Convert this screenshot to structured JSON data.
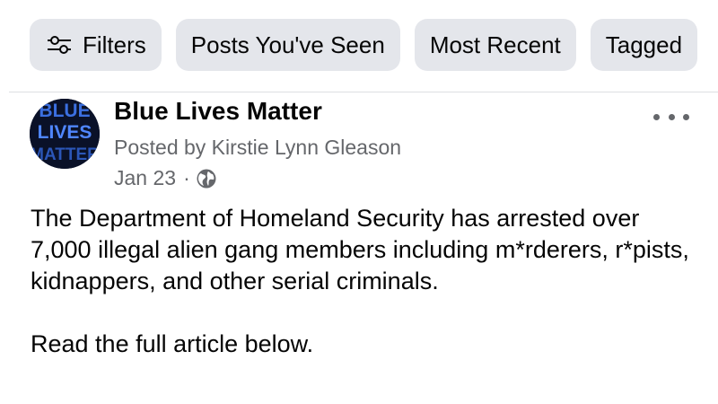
{
  "filters": {
    "chips": [
      {
        "label": "Filters",
        "icon": "sliders-icon"
      },
      {
        "label": "Posts You've Seen"
      },
      {
        "label": "Most Recent"
      },
      {
        "label": "Tagged"
      }
    ]
  },
  "post": {
    "avatar": {
      "icon": "page-avatar",
      "text_lines": [
        "BLUE",
        "LIVES",
        "MATTER"
      ]
    },
    "page_name": "Blue Lives Matter",
    "posted_by": "Posted by Kirstie Lynn Gleason",
    "date": "Jan 23",
    "separator": "·",
    "privacy_icon": "globe-icon",
    "more_icon": "more-options-icon",
    "body_paragraphs": [
      "The Department of Homeland Security has arrested over 7,000 illegal alien gang members including m*rderers, r*pists, kidnappers, and other serial criminals.",
      "Read the full article below."
    ]
  },
  "colors": {
    "chip_bg": "#e4e6eb",
    "secondary_text": "#65676b",
    "primary_text": "#050505",
    "avatar_text": "#3b6fe0"
  }
}
